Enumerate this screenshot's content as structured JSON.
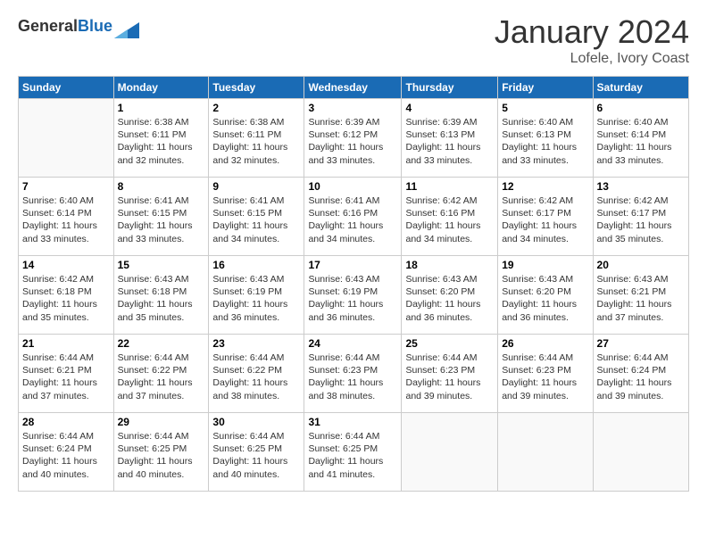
{
  "header": {
    "logo_general": "General",
    "logo_blue": "Blue",
    "month_title": "January 2024",
    "location": "Lofele, Ivory Coast"
  },
  "weekdays": [
    "Sunday",
    "Monday",
    "Tuesday",
    "Wednesday",
    "Thursday",
    "Friday",
    "Saturday"
  ],
  "weeks": [
    [
      {
        "day": "",
        "info": ""
      },
      {
        "day": "1",
        "info": "Sunrise: 6:38 AM\nSunset: 6:11 PM\nDaylight: 11 hours\nand 32 minutes."
      },
      {
        "day": "2",
        "info": "Sunrise: 6:38 AM\nSunset: 6:11 PM\nDaylight: 11 hours\nand 32 minutes."
      },
      {
        "day": "3",
        "info": "Sunrise: 6:39 AM\nSunset: 6:12 PM\nDaylight: 11 hours\nand 33 minutes."
      },
      {
        "day": "4",
        "info": "Sunrise: 6:39 AM\nSunset: 6:13 PM\nDaylight: 11 hours\nand 33 minutes."
      },
      {
        "day": "5",
        "info": "Sunrise: 6:40 AM\nSunset: 6:13 PM\nDaylight: 11 hours\nand 33 minutes."
      },
      {
        "day": "6",
        "info": "Sunrise: 6:40 AM\nSunset: 6:14 PM\nDaylight: 11 hours\nand 33 minutes."
      }
    ],
    [
      {
        "day": "7",
        "info": "Sunrise: 6:40 AM\nSunset: 6:14 PM\nDaylight: 11 hours\nand 33 minutes."
      },
      {
        "day": "8",
        "info": "Sunrise: 6:41 AM\nSunset: 6:15 PM\nDaylight: 11 hours\nand 33 minutes."
      },
      {
        "day": "9",
        "info": "Sunrise: 6:41 AM\nSunset: 6:15 PM\nDaylight: 11 hours\nand 34 minutes."
      },
      {
        "day": "10",
        "info": "Sunrise: 6:41 AM\nSunset: 6:16 PM\nDaylight: 11 hours\nand 34 minutes."
      },
      {
        "day": "11",
        "info": "Sunrise: 6:42 AM\nSunset: 6:16 PM\nDaylight: 11 hours\nand 34 minutes."
      },
      {
        "day": "12",
        "info": "Sunrise: 6:42 AM\nSunset: 6:17 PM\nDaylight: 11 hours\nand 34 minutes."
      },
      {
        "day": "13",
        "info": "Sunrise: 6:42 AM\nSunset: 6:17 PM\nDaylight: 11 hours\nand 35 minutes."
      }
    ],
    [
      {
        "day": "14",
        "info": "Sunrise: 6:42 AM\nSunset: 6:18 PM\nDaylight: 11 hours\nand 35 minutes."
      },
      {
        "day": "15",
        "info": "Sunrise: 6:43 AM\nSunset: 6:18 PM\nDaylight: 11 hours\nand 35 minutes."
      },
      {
        "day": "16",
        "info": "Sunrise: 6:43 AM\nSunset: 6:19 PM\nDaylight: 11 hours\nand 36 minutes."
      },
      {
        "day": "17",
        "info": "Sunrise: 6:43 AM\nSunset: 6:19 PM\nDaylight: 11 hours\nand 36 minutes."
      },
      {
        "day": "18",
        "info": "Sunrise: 6:43 AM\nSunset: 6:20 PM\nDaylight: 11 hours\nand 36 minutes."
      },
      {
        "day": "19",
        "info": "Sunrise: 6:43 AM\nSunset: 6:20 PM\nDaylight: 11 hours\nand 36 minutes."
      },
      {
        "day": "20",
        "info": "Sunrise: 6:43 AM\nSunset: 6:21 PM\nDaylight: 11 hours\nand 37 minutes."
      }
    ],
    [
      {
        "day": "21",
        "info": "Sunrise: 6:44 AM\nSunset: 6:21 PM\nDaylight: 11 hours\nand 37 minutes."
      },
      {
        "day": "22",
        "info": "Sunrise: 6:44 AM\nSunset: 6:22 PM\nDaylight: 11 hours\nand 37 minutes."
      },
      {
        "day": "23",
        "info": "Sunrise: 6:44 AM\nSunset: 6:22 PM\nDaylight: 11 hours\nand 38 minutes."
      },
      {
        "day": "24",
        "info": "Sunrise: 6:44 AM\nSunset: 6:23 PM\nDaylight: 11 hours\nand 38 minutes."
      },
      {
        "day": "25",
        "info": "Sunrise: 6:44 AM\nSunset: 6:23 PM\nDaylight: 11 hours\nand 39 minutes."
      },
      {
        "day": "26",
        "info": "Sunrise: 6:44 AM\nSunset: 6:23 PM\nDaylight: 11 hours\nand 39 minutes."
      },
      {
        "day": "27",
        "info": "Sunrise: 6:44 AM\nSunset: 6:24 PM\nDaylight: 11 hours\nand 39 minutes."
      }
    ],
    [
      {
        "day": "28",
        "info": "Sunrise: 6:44 AM\nSunset: 6:24 PM\nDaylight: 11 hours\nand 40 minutes."
      },
      {
        "day": "29",
        "info": "Sunrise: 6:44 AM\nSunset: 6:25 PM\nDaylight: 11 hours\nand 40 minutes."
      },
      {
        "day": "30",
        "info": "Sunrise: 6:44 AM\nSunset: 6:25 PM\nDaylight: 11 hours\nand 40 minutes."
      },
      {
        "day": "31",
        "info": "Sunrise: 6:44 AM\nSunset: 6:25 PM\nDaylight: 11 hours\nand 41 minutes."
      },
      {
        "day": "",
        "info": ""
      },
      {
        "day": "",
        "info": ""
      },
      {
        "day": "",
        "info": ""
      }
    ]
  ]
}
